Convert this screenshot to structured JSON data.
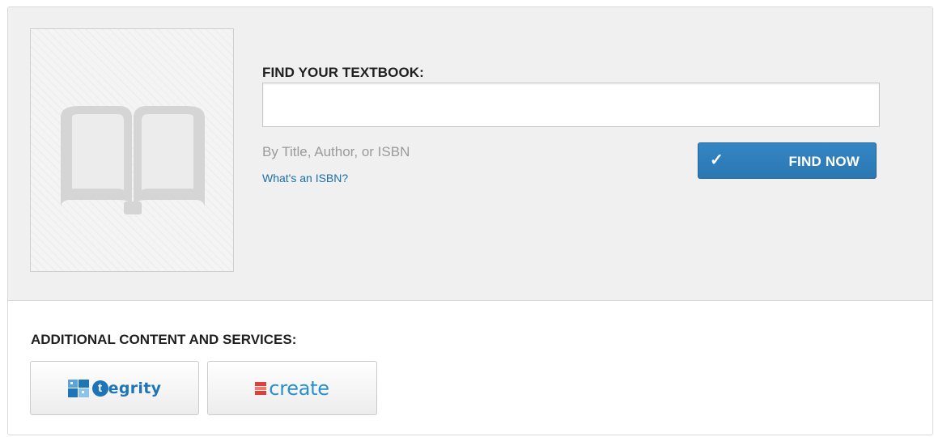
{
  "search": {
    "label": "FIND YOUR TEXTBOOK:",
    "input_value": "",
    "hint": "By Title, Author, or ISBN",
    "isbn_link": "What's an ISBN?",
    "button_label": "FIND NOW",
    "button_icon": "checkmark-icon",
    "button_check": "✓"
  },
  "cover": {
    "icon": "open-book-icon"
  },
  "additional": {
    "label": "ADDITIONAL CONTENT AND SERVICES:",
    "services": [
      {
        "name": "tegrity",
        "icon": "tegrity-logo-icon",
        "logo_letter": "t",
        "logo_text": "egrity"
      },
      {
        "name": "create",
        "icon": "create-logo-icon",
        "logo_text": "create"
      }
    ]
  },
  "colors": {
    "panel_background": "#f0f0f0",
    "button_blue": "#2f7fbe",
    "link_blue": "#1c6fa6",
    "logo_blue": "#1d75b8",
    "create_red": "#e0403a"
  }
}
